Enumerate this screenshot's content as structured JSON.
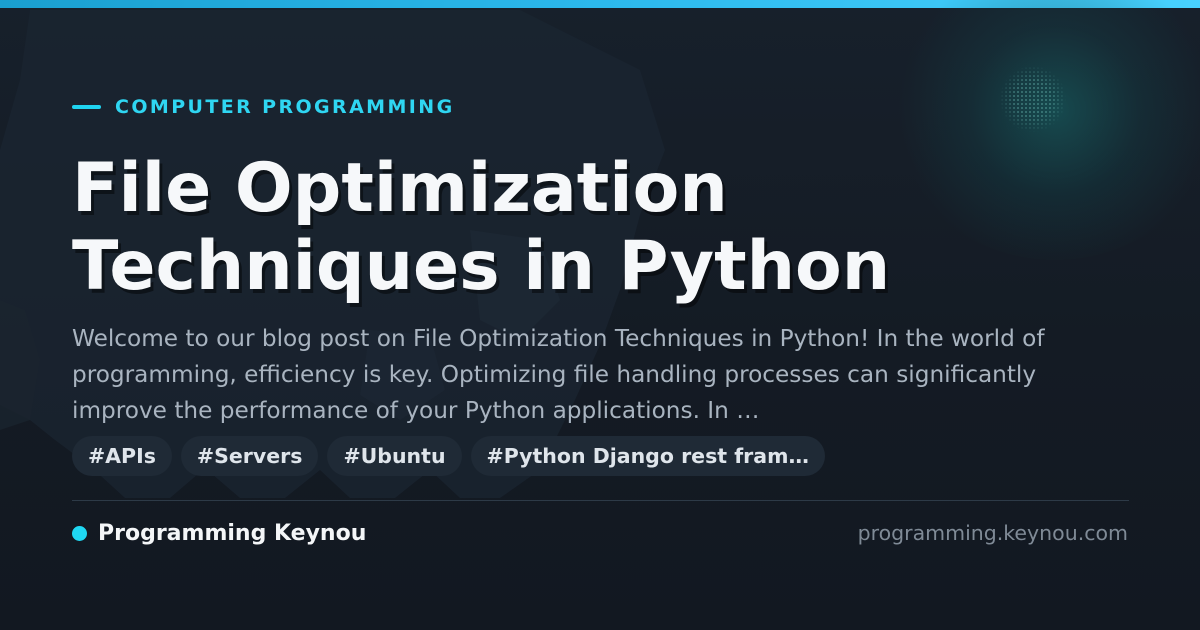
{
  "category": "COMPUTER PROGRAMMING",
  "title_lines": [
    "File Optimization",
    "Techniques in Python"
  ],
  "description": "Welcome to our blog post on File Optimization Techniques in Python! In the world of programming, efficiency is key. Optimizing file handling processes can significantly improve the performance of your Python applications. In …",
  "tags": [
    "#APIs",
    "#Servers",
    "#Ubuntu",
    "#Python Django rest fram…"
  ],
  "brand": "Programming Keynou",
  "domain": "programming.keynou.com",
  "colors": {
    "accent": "#1fd3f0",
    "top_bar": "#2cb8ec",
    "background": "#141b24",
    "title": "#f6f8fa",
    "description": "#a9b4c0",
    "tag_background": "#1f2a36",
    "domain_text": "#7f8a96"
  }
}
